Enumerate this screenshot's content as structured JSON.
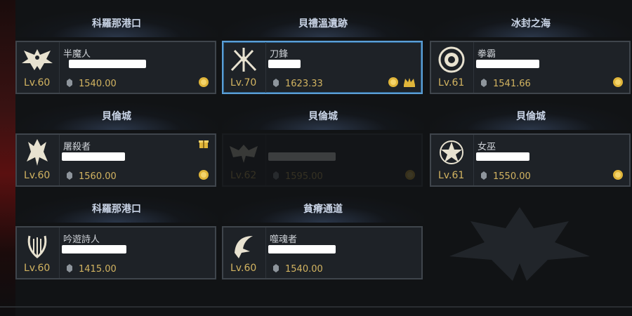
{
  "cards": [
    {
      "location": "科羅那港口",
      "class": "半魔人",
      "level": "Lv.60",
      "item_level": "1540.00",
      "icon": "demon-wings-icon",
      "selected": false,
      "dim": false,
      "badges": [
        "coin"
      ]
    },
    {
      "location": "貝禮溫遺跡",
      "class": "刀鋒",
      "level": "Lv.70",
      "item_level": "1623.33",
      "icon": "blade-icon",
      "selected": true,
      "dim": false,
      "badges": [
        "coin",
        "crown"
      ]
    },
    {
      "location": "冰封之海",
      "class": "拳霸",
      "level": "Lv.61",
      "item_level": "1541.66",
      "icon": "fist-emblem-icon",
      "selected": false,
      "dim": false,
      "badges": [
        "coin"
      ]
    },
    {
      "location": "貝倫城",
      "class": "屠殺者",
      "level": "Lv.60",
      "item_level": "1560.00",
      "icon": "slayer-icon",
      "selected": false,
      "dim": false,
      "badges": [
        "coin",
        "gift"
      ]
    },
    {
      "location": "貝倫城",
      "class": "",
      "level": "Lv.62",
      "item_level": "1595.00",
      "icon": "bat-icon",
      "selected": false,
      "dim": true,
      "badges": [
        "coin"
      ]
    },
    {
      "location": "貝倫城",
      "class": "女巫",
      "level": "Lv.61",
      "item_level": "1550.00",
      "icon": "witch-icon",
      "selected": false,
      "dim": false,
      "badges": [
        "coin"
      ]
    },
    {
      "location": "科羅那港口",
      "class": "吟遊詩人",
      "level": "Lv.60",
      "item_level": "1415.00",
      "icon": "lyre-icon",
      "selected": false,
      "dim": false,
      "badges": []
    },
    {
      "location": "貧瘠通道",
      "class": "噬魂者",
      "level": "Lv.60",
      "item_level": "1540.00",
      "icon": "reaper-icon",
      "selected": false,
      "dim": false,
      "badges": []
    }
  ],
  "colors": {
    "level": "#d3b461",
    "selected_border": "#5b9fd6",
    "card_border": "#3f454c"
  }
}
